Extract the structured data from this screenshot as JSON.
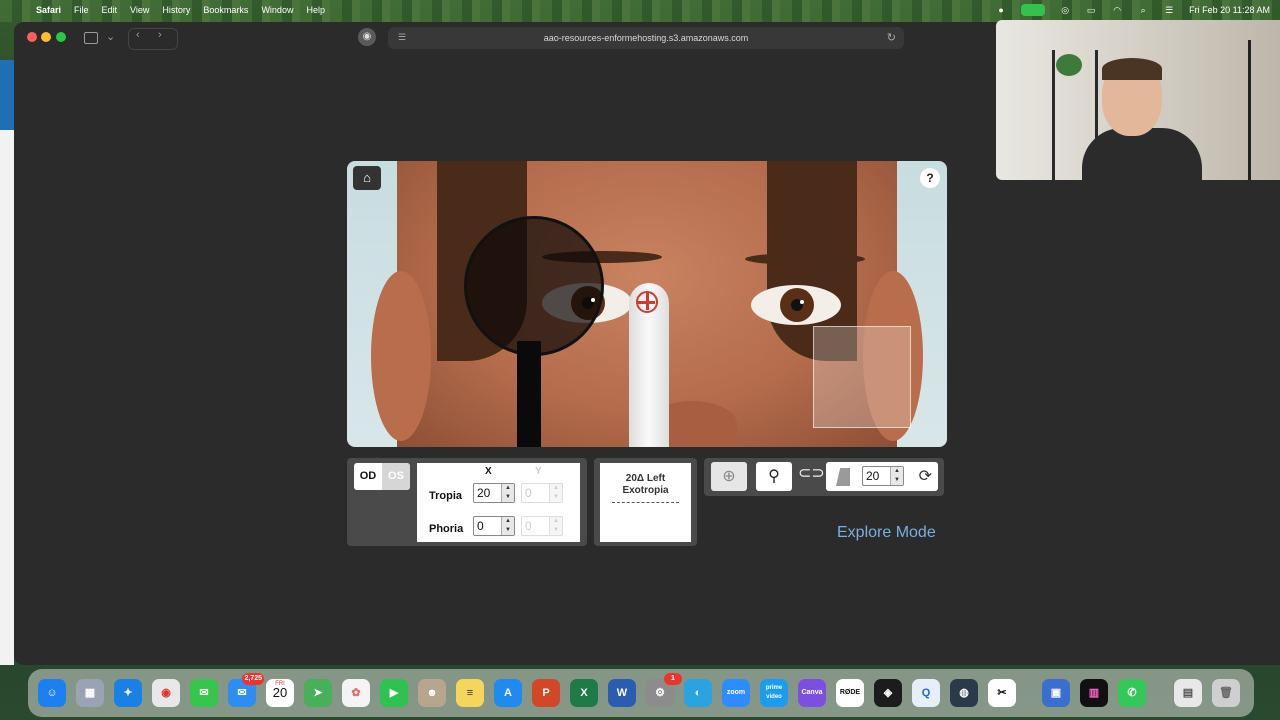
{
  "menubar": {
    "app": "Safari",
    "items": [
      "File",
      "Edit",
      "View",
      "History",
      "Bookmarks",
      "Window",
      "Help"
    ],
    "datetime": "Fri Feb 20  11:28 AM"
  },
  "browser": {
    "url": "aao-resources-enformehosting.s3.amazonaws.com"
  },
  "simulator": {
    "help_label": "?",
    "eye_toggle": {
      "od": "OD",
      "os": "OS"
    },
    "measurement": {
      "col_x": "X",
      "col_y": "Y",
      "tropia_label": "Tropia",
      "phoria_label": "Phoria",
      "tropia_x": "20",
      "tropia_y": "0",
      "phoria_x": "0",
      "phoria_y": "0"
    },
    "diagnosis": {
      "line1": "20Δ Left",
      "line2": "Exotropia"
    },
    "prism_value": "20",
    "mode_label": "Explore Mode"
  },
  "dock": {
    "calendar_day": "20",
    "calendar_month": "FRI",
    "mail_badge": "2,725",
    "settings_badge": "1",
    "apps": [
      {
        "label": "",
        "color": "#1d7ff0"
      },
      {
        "label": "",
        "color": "#9aa3b5"
      },
      {
        "label": "",
        "color": "#1a7fe6"
      },
      {
        "label": "",
        "color": "#e8e8e8"
      },
      {
        "label": "",
        "color": "#36c54d"
      },
      {
        "label": "",
        "color": "#2f8cf0"
      },
      {
        "label": "",
        "color": "#ffffff"
      },
      {
        "label": "",
        "color": "#46b05a"
      },
      {
        "label": "",
        "color": "#f4f4f4"
      },
      {
        "label": "",
        "color": "#2ec250"
      },
      {
        "label": "",
        "color": "#b8a58e"
      },
      {
        "label": "",
        "color": "#f6d55c"
      },
      {
        "label": "",
        "color": "#1f8af0"
      },
      {
        "label": "",
        "color": "#d24726"
      },
      {
        "label": "",
        "color": "#1e7b45"
      },
      {
        "label": "",
        "color": "#2a5db0"
      },
      {
        "label": "",
        "color": "#8c8c8c"
      },
      {
        "label": "",
        "color": "#2aa3e0"
      },
      {
        "label": "zoom",
        "color": "#2d8cff"
      },
      {
        "label": "prime video",
        "color": "#1b9cf2"
      },
      {
        "label": "Canva",
        "color": "#7d4fe0"
      },
      {
        "label": "RØDE",
        "color": "#ffffff"
      },
      {
        "label": "",
        "color": "#1c1c1c"
      },
      {
        "label": "",
        "color": "#e6eef8"
      },
      {
        "label": "",
        "color": "#2a3a4a"
      },
      {
        "label": "",
        "color": "#ffffff"
      },
      {
        "label": "",
        "color": "#3a6fd0"
      },
      {
        "label": "",
        "color": "#111111"
      },
      {
        "label": "",
        "color": "#34c759"
      }
    ]
  }
}
